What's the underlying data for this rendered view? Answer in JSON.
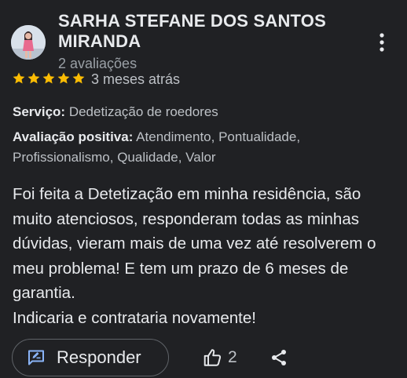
{
  "review": {
    "reviewer_name": "SARHA STEFANE DOS SANTOS MIRANDA",
    "review_count": "2 avaliações",
    "rating": 5,
    "rating_max": 5,
    "date": "3 meses atrás",
    "service_label": "Serviço:",
    "service_value": "Dedetização de roedores",
    "positive_label": "Avaliação positiva:",
    "positive_value": "Atendimento, Pontualidade, Profissionalismo, Qualidade, Valor",
    "text": "Foi feita a Detetização em minha residência, são muito atenciosos, responderam todas as minhas dúvidas, vieram mais de uma vez até resolverem o meu problema! E tem um prazo de 6 meses de garantia.\nIndicaria e contrataria novamente!"
  },
  "actions": {
    "reply_label": "Responder",
    "reply_icon": "reply-icon",
    "like_icon": "thumb-up-icon",
    "like_count": "2",
    "share_icon": "share-icon",
    "more_icon": "more-vert-icon"
  },
  "colors": {
    "background": "#202124",
    "text_primary": "#e8eaed",
    "text_secondary": "#9aa0a6",
    "star": "#fbbc04",
    "reply_icon": "#8ab4f8",
    "button_border": "#5f6368"
  }
}
